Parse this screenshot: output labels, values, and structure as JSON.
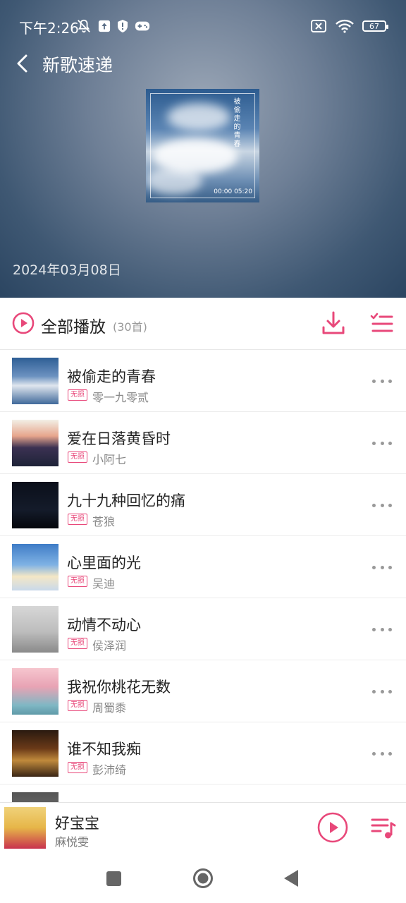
{
  "status_bar": {
    "time": "下午2:26",
    "battery": "67"
  },
  "header": {
    "title": "新歌速递",
    "release_date": "2024年03月08日",
    "cover_text": "被偷走的青春",
    "cover_time": "00:00 05:20"
  },
  "play_all": {
    "label": "全部播放",
    "count": "(30首)"
  },
  "songs": [
    {
      "title": "被偷走的青春",
      "badge": "无损",
      "artist": "零一九零贰"
    },
    {
      "title": "爱在日落黄昏时",
      "badge": "无损",
      "artist": "小阿七"
    },
    {
      "title": "九十九种回忆的痛",
      "badge": "无损",
      "artist": "苍狼"
    },
    {
      "title": "心里面的光",
      "badge": "无损",
      "artist": "吴迪"
    },
    {
      "title": "动情不动心",
      "badge": "无损",
      "artist": "侯泽润"
    },
    {
      "title": "我祝你桃花无数",
      "badge": "无损",
      "artist": "周蜀黍"
    },
    {
      "title": "谁不知我痴",
      "badge": "无损",
      "artist": "彭沛绮"
    }
  ],
  "mini_player": {
    "title": "好宝宝",
    "artist": "麻悦雯"
  },
  "colors": {
    "accent": "#e8487a"
  },
  "icons": {
    "back": "chevron-left-icon",
    "play_all": "play-circle-icon",
    "download": "download-icon",
    "manage": "list-check-icon",
    "more": "more-horizontal-icon",
    "queue": "playlist-icon"
  }
}
